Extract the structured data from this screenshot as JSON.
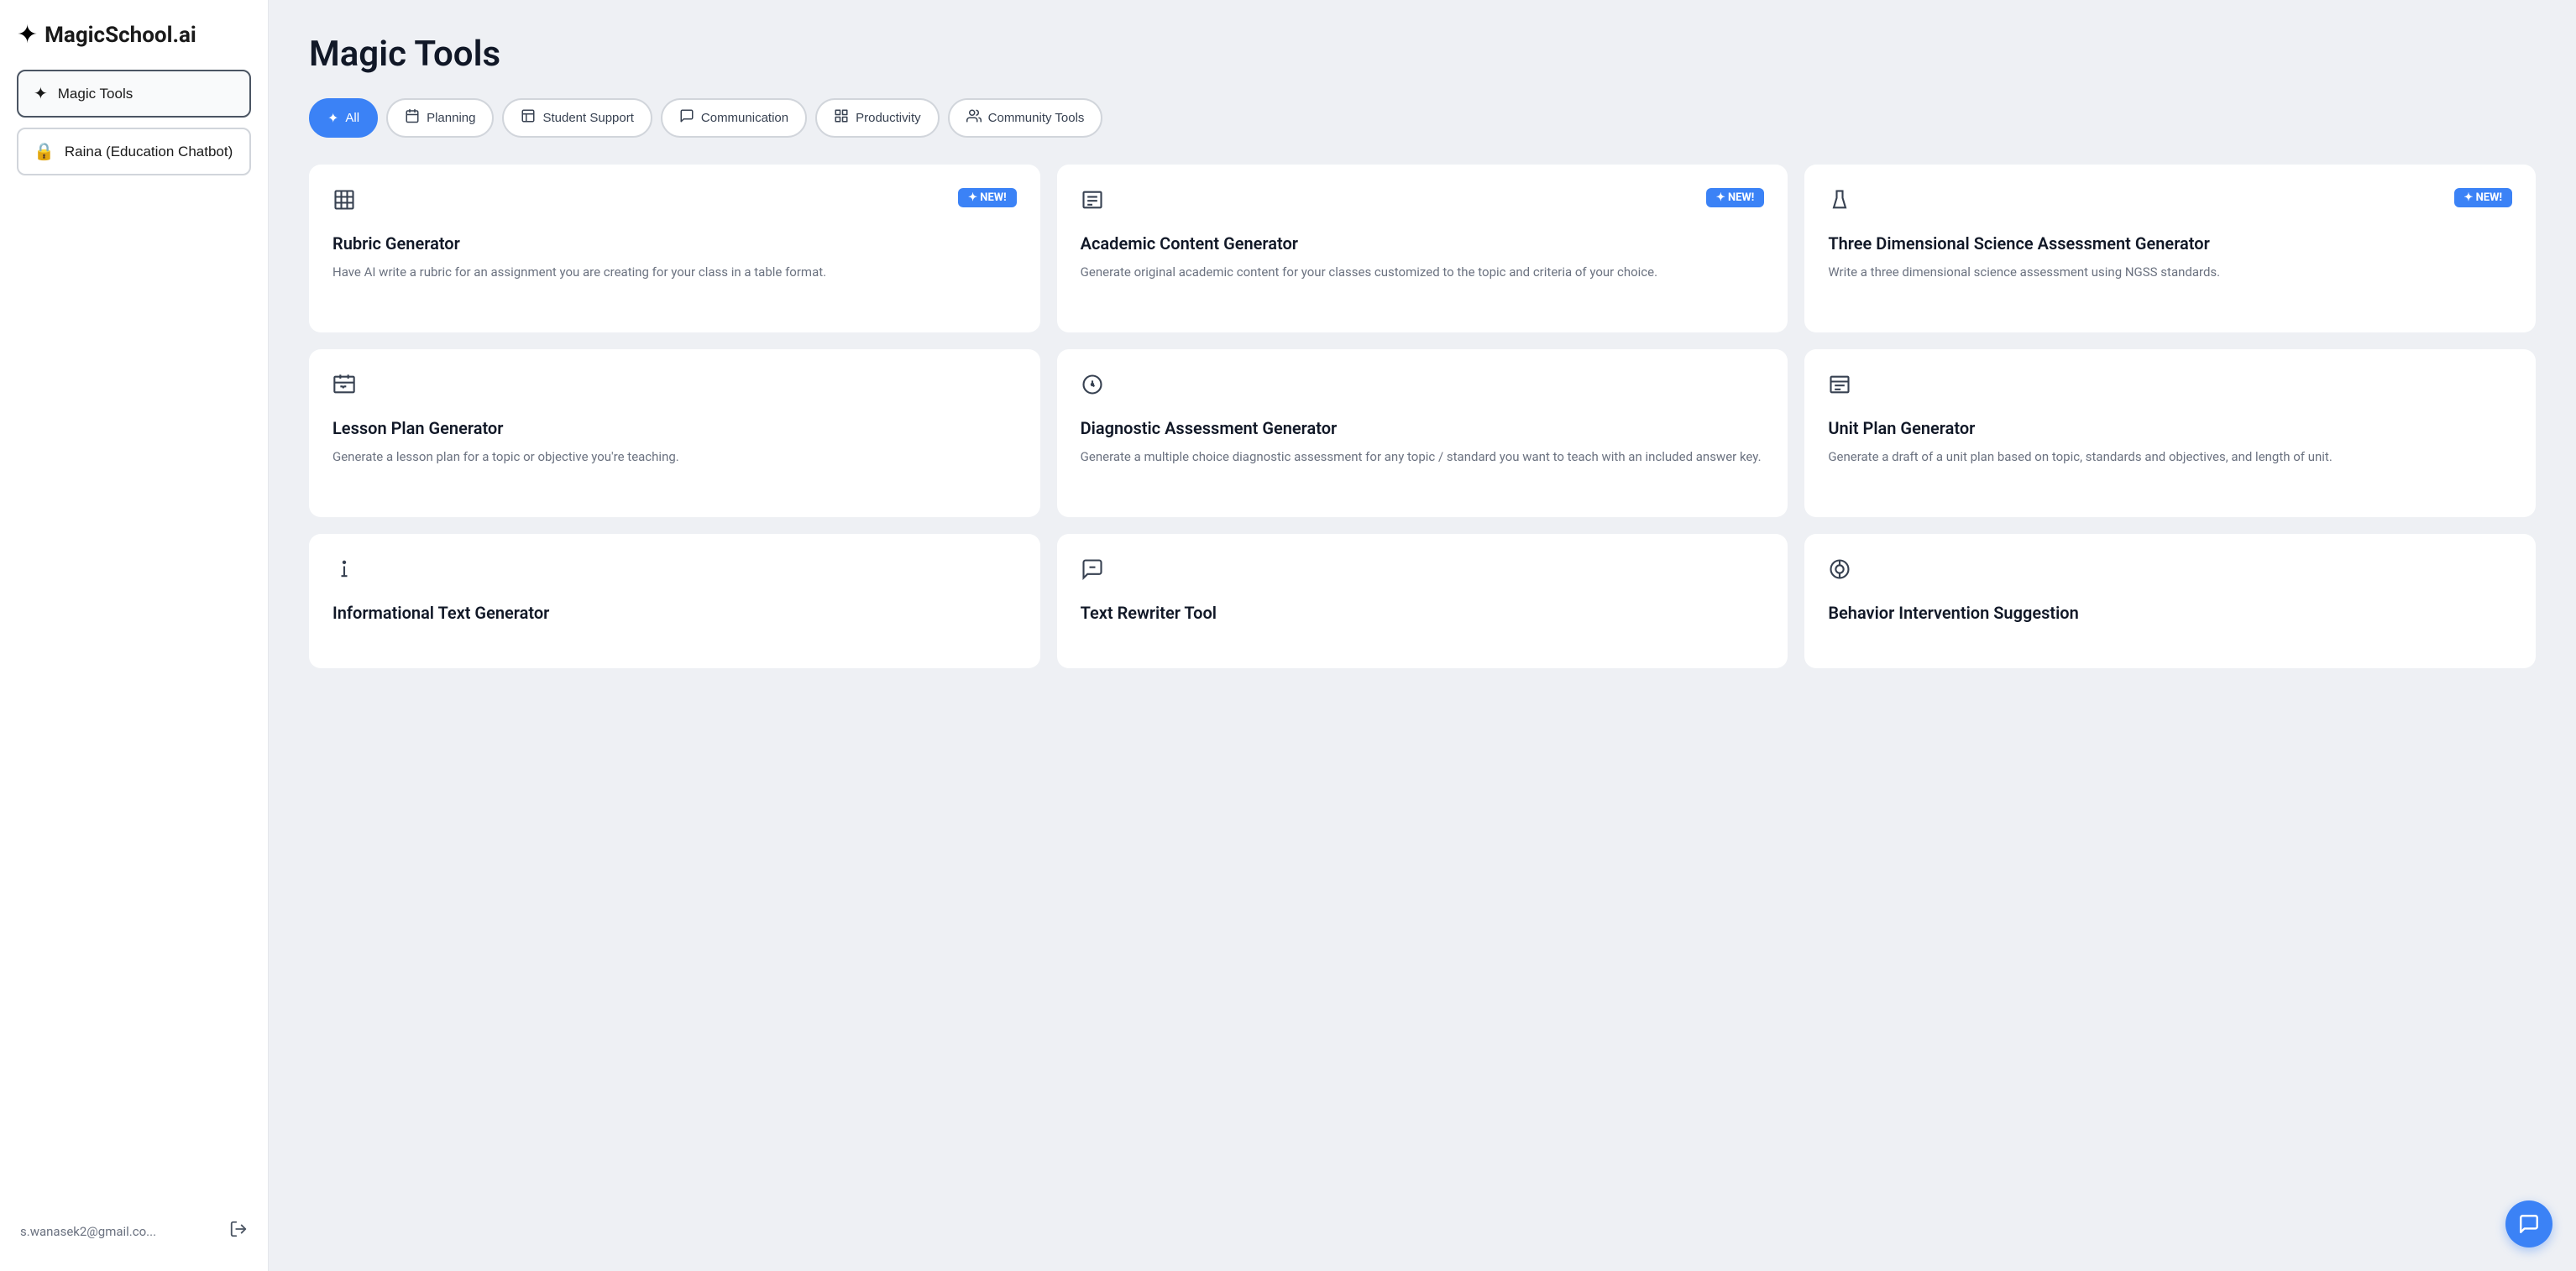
{
  "sidebar": {
    "logo_text": "MagicSchool.ai",
    "nav_items": [
      {
        "id": "magic-tools",
        "label": "Magic Tools",
        "icon": "✦",
        "active": true
      },
      {
        "id": "raina",
        "label": "Raina (Education Chatbot)",
        "icon": "🔒",
        "active": false
      }
    ],
    "user_email": "s.wanasek2@gmail.co...",
    "logout_icon": "logout"
  },
  "main": {
    "page_title": "Magic Tools",
    "filter_tabs": [
      {
        "id": "all",
        "label": "All",
        "icon": "✦",
        "active": true
      },
      {
        "id": "planning",
        "label": "Planning",
        "icon": "📅",
        "active": false
      },
      {
        "id": "student-support",
        "label": "Student Support",
        "icon": "📋",
        "active": false
      },
      {
        "id": "communication",
        "label": "Communication",
        "icon": "💬",
        "active": false
      },
      {
        "id": "productivity",
        "label": "Productivity",
        "icon": "⊞",
        "active": false
      },
      {
        "id": "community-tools",
        "label": "Community Tools",
        "icon": "👥",
        "active": false
      }
    ],
    "tool_cards": [
      {
        "id": "rubric-generator",
        "icon": "grid",
        "is_new": true,
        "title": "Rubric Generator",
        "description": "Have AI write a rubric for an assignment you are creating for your class in a table format."
      },
      {
        "id": "academic-content-generator",
        "icon": "doc",
        "is_new": true,
        "title": "Academic Content Generator",
        "description": "Generate original academic content for your classes customized to the topic and criteria of your choice."
      },
      {
        "id": "three-dimensional-science",
        "icon": "beaker",
        "is_new": true,
        "title": "Three Dimensional Science Assessment Generator",
        "description": "Write a three dimensional science assessment using NGSS standards."
      },
      {
        "id": "lesson-plan-generator",
        "icon": "lesson",
        "is_new": false,
        "title": "Lesson Plan Generator",
        "description": "Generate a lesson plan for a topic or objective you're teaching."
      },
      {
        "id": "diagnostic-assessment-generator",
        "icon": "diagnostic",
        "is_new": false,
        "title": "Diagnostic Assessment Generator",
        "description": "Generate a multiple choice diagnostic assessment for any topic / standard you want to teach with an included answer key."
      },
      {
        "id": "unit-plan-generator",
        "icon": "unit",
        "is_new": false,
        "title": "Unit Plan Generator",
        "description": "Generate a draft of a unit plan based on topic, standards and objectives, and length of unit."
      },
      {
        "id": "informational-text-generator",
        "icon": "info",
        "is_new": false,
        "title": "Informational Text Generator",
        "description": ""
      },
      {
        "id": "text-rewriter-tool",
        "icon": "rewrite",
        "is_new": false,
        "title": "Text Rewriter Tool",
        "description": ""
      },
      {
        "id": "behavior-intervention-suggestion",
        "icon": "behavior",
        "is_new": false,
        "title": "Behavior Intervention Suggestion",
        "description": ""
      }
    ],
    "new_badge_label": "✦ NEW!"
  }
}
